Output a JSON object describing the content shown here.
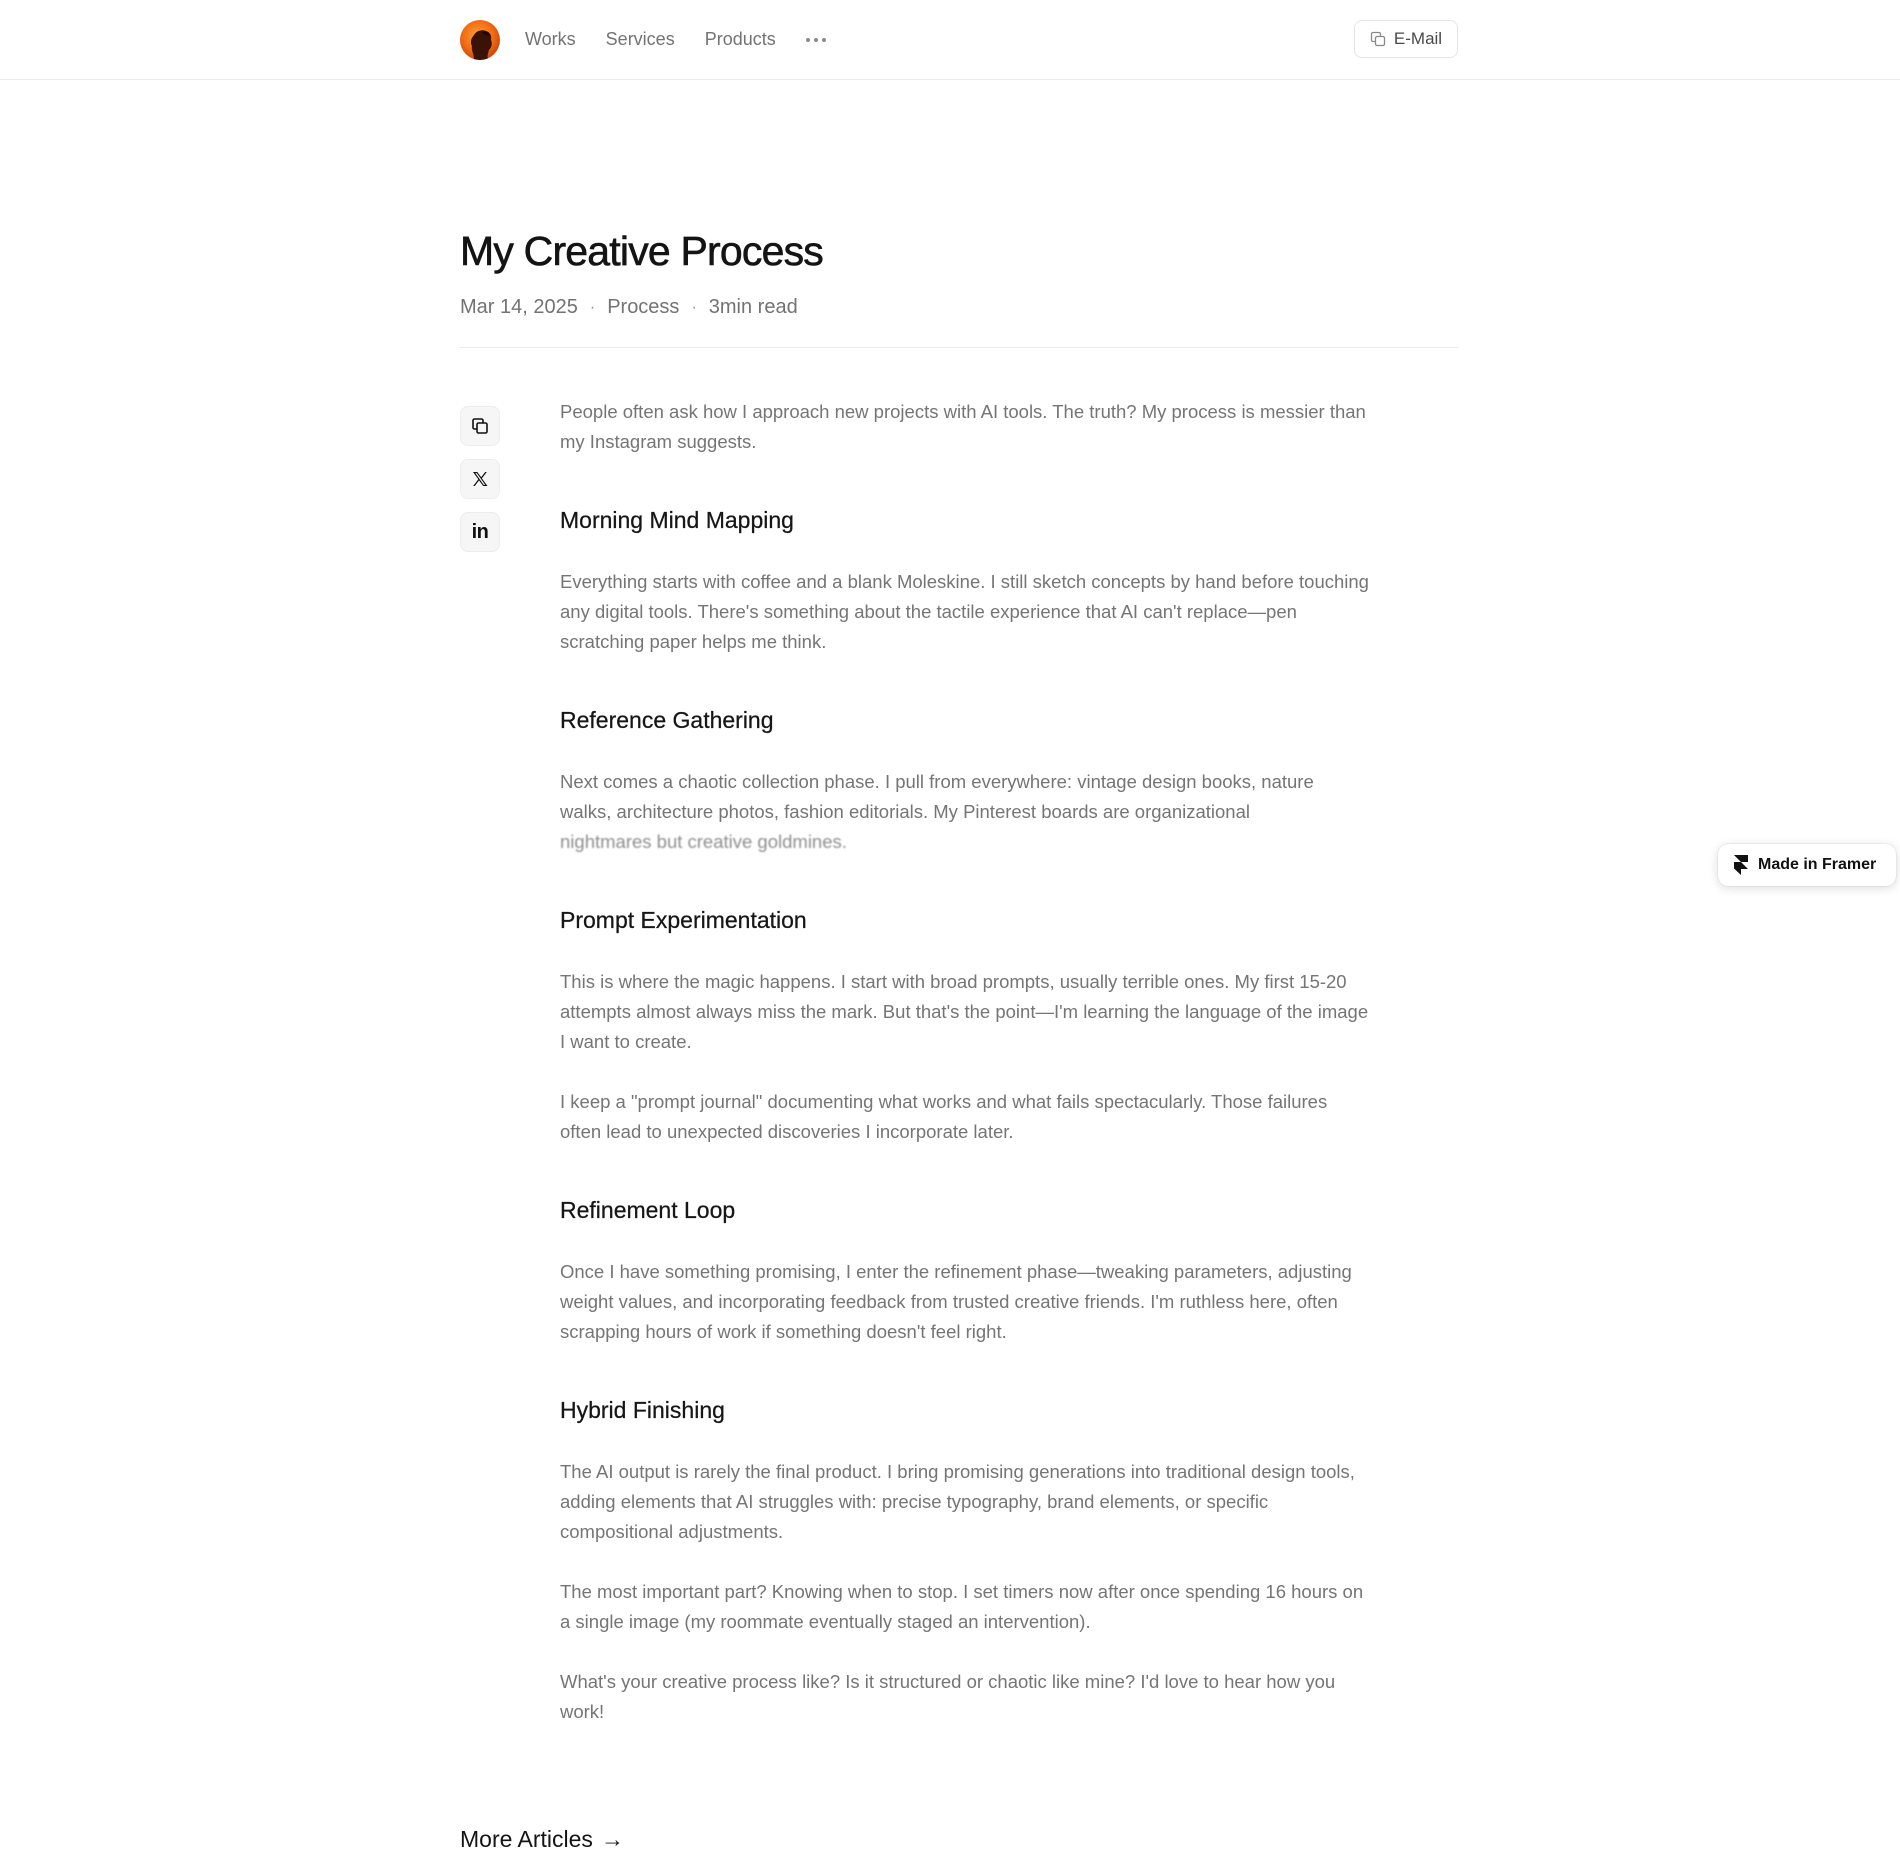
{
  "nav": {
    "avatar_icon": "avatar-silhouette",
    "links": [
      "Works",
      "Services",
      "Products"
    ],
    "more_icon": "ellipsis-icon",
    "email_label": "E-Mail"
  },
  "article": {
    "title": "My Creative Process",
    "date": "Mar 14, 2025",
    "category": "Process",
    "read_time": "3min read",
    "separator": "·",
    "intro": "People often ask how I approach new projects with AI tools. The truth? My process is messier than my Instagram suggests.",
    "sections": [
      {
        "heading": "Morning Mind Mapping",
        "paragraphs": [
          "Everything starts with coffee and a blank Moleskine. I still sketch concepts by hand before touching any digital tools. There's something about the tactile experience that AI can't replace—pen scratching paper helps me think."
        ]
      },
      {
        "heading": "Reference Gathering",
        "paragraphs": [
          "Next comes a chaotic collection phase. I pull from everywhere: vintage design books, nature walks, architecture photos, fashion editorials. My Pinterest boards are organizational",
          "nightmares but creative goldmines."
        ]
      },
      {
        "heading": "Prompt Experimentation",
        "paragraphs": [
          "This is where the magic happens. I start with broad prompts, usually terrible ones. My first 15-20 attempts almost always miss the mark. But that's the point—I'm learning the language of the image I want to create.",
          "I keep a \"prompt journal\" documenting what works and what fails spectacularly. Those failures often lead to unexpected discoveries I incorporate later."
        ]
      },
      {
        "heading": "Refinement Loop",
        "paragraphs": [
          "Once I have something promising, I enter the refinement phase—tweaking parameters, adjusting weight values, and incorporating feedback from trusted creative friends. I'm ruthless here, often scrapping hours of work if something doesn't feel right."
        ]
      },
      {
        "heading": "Hybrid Finishing",
        "paragraphs": [
          "The AI output is rarely the final product. I bring promising generations into traditional design tools, adding elements that AI struggles with: precise typography, brand elements, or specific compositional adjustments.",
          "The most important part? Knowing when to stop. I set timers now after once spending 16 hours on a single image (my roommate eventually staged an intervention).",
          "What's your creative process like? Is it structured or chaotic like mine? I'd love to hear how you work!"
        ]
      }
    ]
  },
  "share": {
    "icons": [
      "copy-link-icon",
      "x-icon",
      "linkedin-icon"
    ],
    "linkedin_glyph": "in"
  },
  "footer": {
    "more_articles": "More Articles",
    "arrow": "→"
  },
  "badge": {
    "label": "Made in Framer",
    "icon": "framer-icon"
  }
}
